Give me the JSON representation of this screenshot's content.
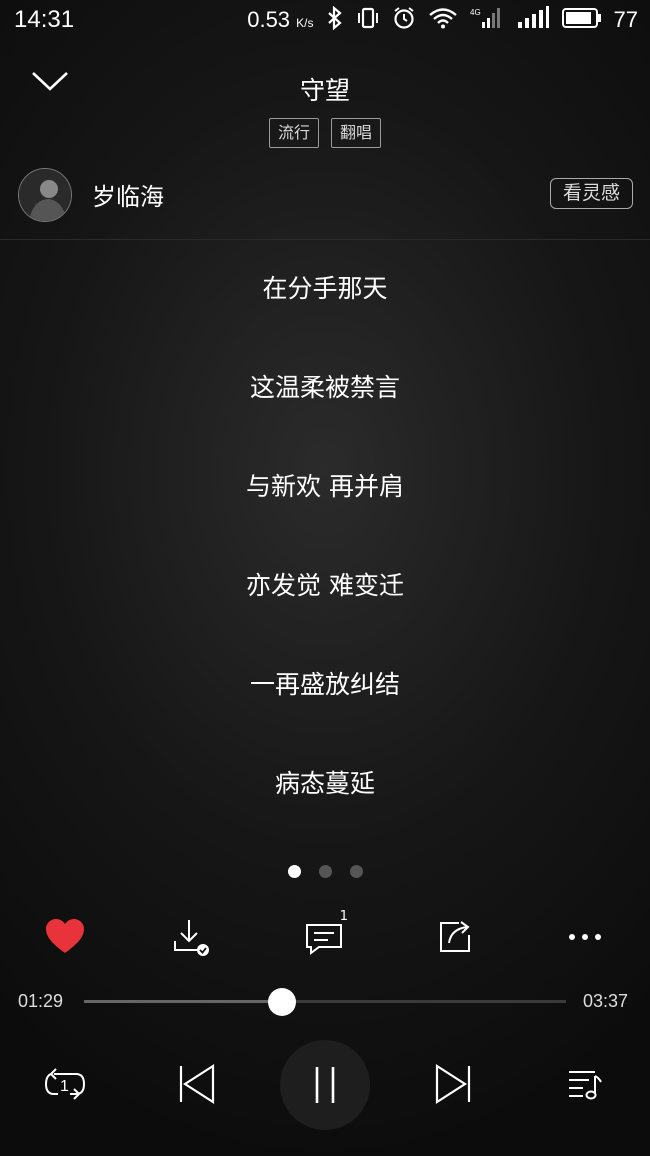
{
  "status_bar": {
    "time": "14:31",
    "speed_value": "0.53",
    "speed_unit": "K/s",
    "battery_level": "77",
    "network_label": "4G"
  },
  "header": {
    "song_title": "守望",
    "tags": [
      "流行",
      "翻唱"
    ]
  },
  "artist": {
    "name": "岁临海",
    "inspiration_button": "看灵感"
  },
  "lyrics": [
    "在分手那天",
    "这温柔被禁言",
    "与新欢  再并肩",
    "亦发觉  难变迁",
    "一再盛放纠结",
    "病态蔓延"
  ],
  "pager": {
    "total": 3,
    "active_index": 0
  },
  "actions": {
    "comment_count": "1",
    "liked": true
  },
  "playback": {
    "current_time": "01:29",
    "total_time": "03:37",
    "progress_fraction": 0.41,
    "state": "playing"
  },
  "colors": {
    "heart": "#e8333b",
    "accent_white": "#ffffff"
  }
}
